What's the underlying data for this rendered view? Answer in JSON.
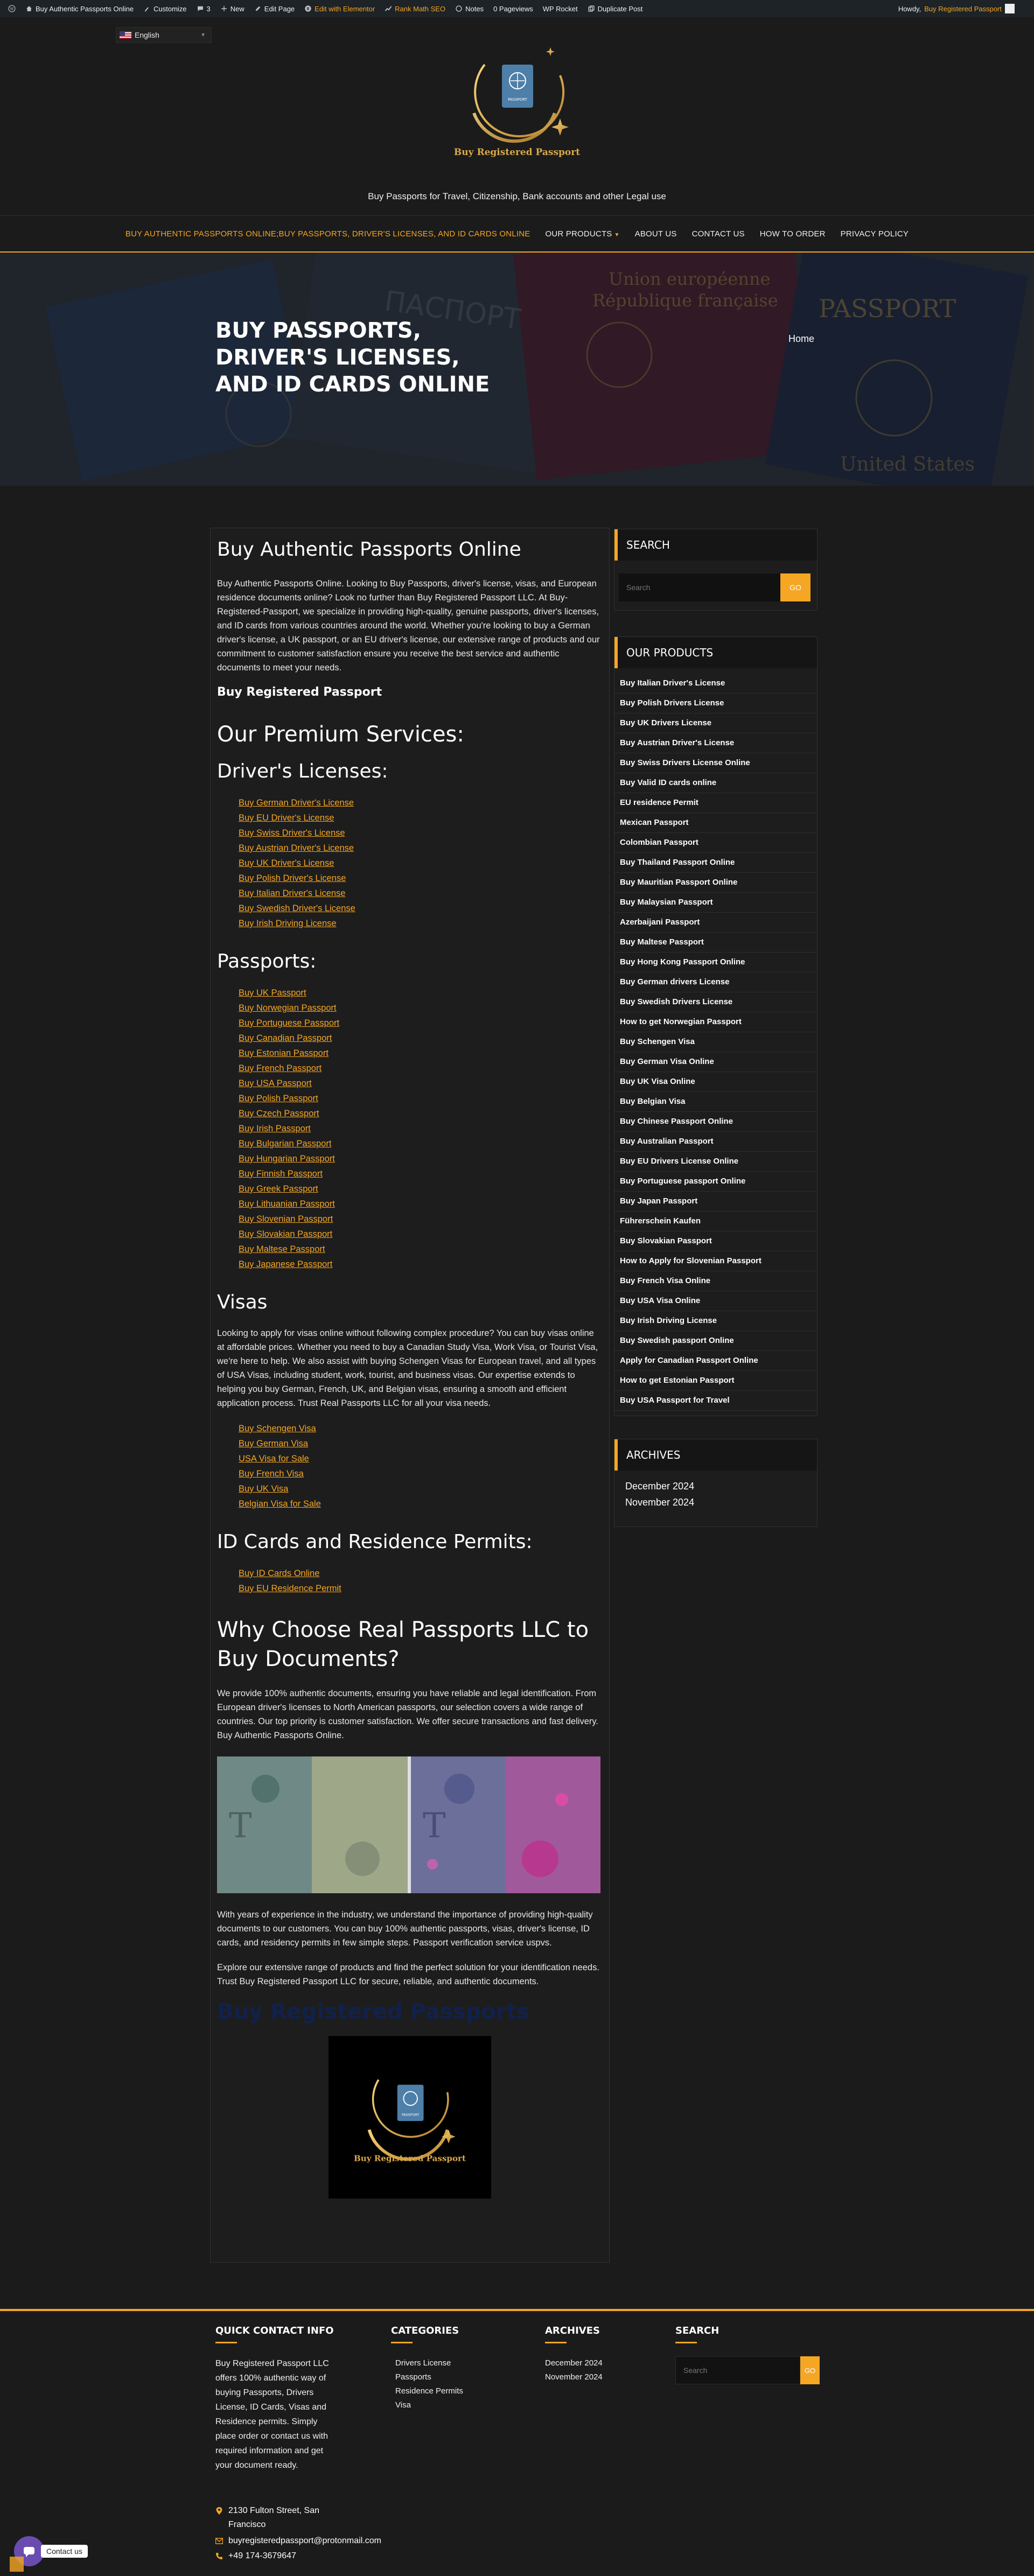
{
  "admin_bar": {
    "site_name": "Buy Authentic Passports Online",
    "customize": "Customize",
    "comments_count": "3",
    "new": "New",
    "edit_page": "Edit Page",
    "elementor": "Edit with Elementor",
    "rank_math": "Rank Math SEO",
    "notes": "Notes",
    "pageviews": "0 Pageviews",
    "wp_rocket": "WP Rocket",
    "duplicate": "Duplicate Post",
    "howdy": "Howdy,",
    "user": "Buy Registered Passport"
  },
  "header": {
    "language": "English",
    "logo_text": "Buy Registered Passport",
    "logo_passport": "PASSPORT",
    "tagline": "Buy Passports for Travel, Citizenship, Bank accounts and other Legal use"
  },
  "nav": {
    "items": [
      {
        "label": "Buy Authentic Passports Online;Buy Passports, Driver's Licenses, and ID Cards Online",
        "active": true
      },
      {
        "label": "Our Products",
        "dropdown": true
      },
      {
        "label": "About us"
      },
      {
        "label": "Contact Us"
      },
      {
        "label": "How to Order"
      },
      {
        "label": "Privacy Policy"
      }
    ]
  },
  "hero": {
    "title": "Buy Passports, Driver's Licenses, and ID Cards Online",
    "breadcrumb": "Home",
    "bg_texts": [
      "ПАСПОРТ",
      "Union européenne",
      "République française",
      "PASSPORT",
      "PASSPORT",
      "United States"
    ]
  },
  "content": {
    "title": "Buy Authentic Passports Online",
    "intro": "Buy Authentic Passports Online. Looking to Buy Passports, driver's license, visas, and European residence documents online? Look no further than Buy Registered Passport LLC. At Buy-Registered-Passport, we specialize in providing high-quality, genuine passports, driver's licenses, and ID cards from various countries around the world. Whether you're looking to buy a German driver's license, a UK passport, or an EU driver's license, our extensive range of products and our commitment to customer satisfaction ensure you receive the best service and authentic documents to meet your needs.",
    "brand_heading": "Buy Registered Passport",
    "services_heading": "Our Premium Services:",
    "drivers_heading": "Driver's Licenses:",
    "drivers_links": [
      "Buy German Driver's License",
      "Buy EU Driver's License",
      "Buy Swiss Driver's License",
      "Buy Austrian Driver's License",
      "Buy UK Driver's License",
      "Buy Polish Driver's License",
      "Buy Italian Driver's License",
      "Buy Swedish Driver's License",
      "Buy Irish Driving License"
    ],
    "passports_heading": "Passports:",
    "passport_links": [
      "Buy UK Passport",
      "Buy Norwegian Passport",
      "Buy Portuguese Passport",
      "Buy Canadian Passport",
      "Buy Estonian Passport",
      "Buy French Passport",
      "Buy USA Passport",
      "Buy Polish Passport",
      "Buy Czech Passport",
      "Buy Irish Passport",
      "Buy Bulgarian Passport",
      "Buy Hungarian Passport",
      "Buy Finnish Passport",
      "Buy Greek Passport",
      "Buy Lithuanian Passport",
      "Buy Slovenian Passport",
      "Buy Slovakian Passport",
      "Buy Maltese Passport",
      "Buy Japanese Passport"
    ],
    "visas_heading": "Visas",
    "visas_text": "Looking to apply for visas online without following complex procedure? You can buy visas online at affordable prices. Whether you need to buy a Canadian Study Visa, Work Visa, or Tourist Visa, we're here to help. We also assist with buying Schengen Visas for European travel, and all types of USA Visas, including student, work, tourist, and business visas. Our expertise extends to helping you buy German, French, UK, and Belgian visas, ensuring a smooth and efficient application process. Trust Real Passports LLC for all your visa needs.",
    "visa_links": [
      "Buy Schengen Visa",
      "Buy German Visa",
      "USA Visa for Sale",
      "Buy French Visa",
      "Buy UK Visa",
      "Belgian Visa for Sale"
    ],
    "id_heading": "ID Cards and Residence Permits:",
    "id_links": [
      "Buy ID Cards Online",
      "Buy EU Residence Permit"
    ],
    "why_heading": "Why Choose Real Passports LLC to Buy Documents?",
    "why_text": "We provide 100% authentic documents, ensuring you have reliable and legal identification. From European driver's licenses to North American passports, our selection covers a wide range of countries. Our top priority is customer satisfaction. We offer secure transactions and fast delivery. Buy Authentic Passports Online.",
    "experience_text": "With years of experience in the industry, we understand the importance of providing high-quality documents to our customers. You can buy 100% authentic passports, visas, driver's license, ID cards, and residency permits in few simple steps. Passport verification service uspvs.",
    "explore_text": "Explore our extensive range of products and find the perfect solution for your identification needs. Trust Buy Registered Passport LLC for secure, reliable, and authentic documents.",
    "blue_heading": "Buy Registered Passports",
    "logo_text": "Buy Registered Passport",
    "logo_passport": "PASSPORT"
  },
  "sidebar": {
    "search_title": "Search",
    "search_placeholder": "Search",
    "search_button": "GO",
    "products_title": "Our Products",
    "products": [
      "Buy Italian Driver's License",
      "Buy Polish Drivers License",
      "Buy UK Drivers License",
      "Buy Austrian Driver's License",
      "Buy Swiss Drivers License Online",
      "Buy Valid ID cards online",
      "EU residence Permit",
      "Mexican Passport",
      "Colombian Passport",
      "Buy Thailand Passport Online",
      "Buy Mauritian Passport Online",
      "Buy Malaysian Passport",
      "Azerbaijani Passport",
      "Buy Maltese Passport",
      "Buy Hong Kong Passport Online",
      "Buy German drivers License",
      "Buy Swedish Drivers License",
      "How to get Norwegian Passport",
      "Buy Schengen Visa",
      "Buy German Visa Online",
      "Buy UK Visa Online",
      "Buy Belgian Visa",
      "Buy Chinese Passport Online",
      "Buy Australian Passport",
      "Buy EU Drivers License Online",
      "Buy Portuguese passport Online",
      "Buy Japan Passport",
      "Führerschein Kaufen",
      "Buy Slovakian Passport",
      "How to Apply for Slovenian Passport",
      "Buy French Visa Online",
      "Buy USA Visa Online",
      "Buy Irish Driving License",
      "Buy Swedish passport Online",
      "Apply for Canadian Passport Online",
      "How to get Estonian Passport",
      "Buy USA Passport for Travel"
    ],
    "archives_title": "Archives",
    "archives": [
      "December 2024",
      "November 2024"
    ]
  },
  "footer": {
    "contact_title": "Quick Contact Info",
    "contact_text": "Buy Registered Passport LLC offers 100% authentic way of buying Passports, Drivers License, ID Cards, Visas and Residence permits. Simply place order or contact us with required information and get your document ready.",
    "categories_title": "Categories",
    "categories": [
      "Drivers License",
      "Passports",
      "Residence Permits",
      "Visa"
    ],
    "archives_title": "Archives",
    "archives": [
      "December 2024",
      "November 2024"
    ],
    "search_title": "Search",
    "search_placeholder": "Search",
    "search_button": "GO",
    "address_line1": "2130 Fulton Street, San",
    "address_line2": "Francisco",
    "email": "buyregisteredpassport@protonmail.com",
    "phone": "+49 174-3679647",
    "chat_label": "Contact us"
  },
  "colors": {
    "accent": "#f5a623",
    "background": "#1b1b1b",
    "panel": "#1d1d1d",
    "blue_heading": "#11214d"
  }
}
